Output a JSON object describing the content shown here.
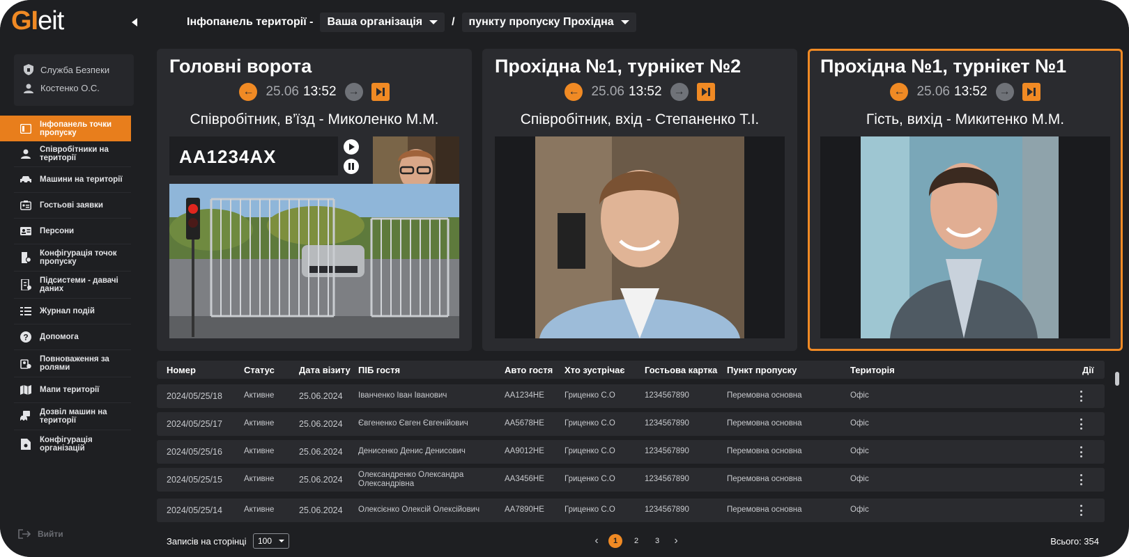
{
  "app": {
    "logo_prefix": "GI",
    "logo_suffix": "eit"
  },
  "header": {
    "title": "Інфопанель території -",
    "org_select": "Ваша організація",
    "separator": "/",
    "checkpoint_select": "пункту пропуску Прохідна"
  },
  "user": {
    "service": "Служба Безпеки",
    "name": "Костенко О.С."
  },
  "sidebar": {
    "items": [
      {
        "label": "Інфопанель точки пропуску",
        "icon": "dashboard-icon",
        "active": true
      },
      {
        "label": "Співробітники на території",
        "icon": "person-icon"
      },
      {
        "label": "Машини на території",
        "icon": "car-icon"
      },
      {
        "label": "Гостьові заявки",
        "icon": "guest-card-icon"
      },
      {
        "label": "Персони",
        "icon": "id-card-icon"
      },
      {
        "label": "Конфігурація точок пропуску",
        "icon": "door-config-icon"
      },
      {
        "label": "Підсистеми - давачі даних",
        "icon": "subsystems-icon"
      },
      {
        "label": "Журнал подій",
        "icon": "event-log-icon"
      },
      {
        "label": "Допомога",
        "icon": "help-icon"
      },
      {
        "label": "Повноваження за ролями",
        "icon": "roles-icon"
      },
      {
        "label": "Мапи території",
        "icon": "map-icon"
      },
      {
        "label": "Дозвіл машин на території",
        "icon": "vehicle-permit-icon"
      },
      {
        "label": "Конфігурація організацій",
        "icon": "org-config-icon"
      }
    ],
    "logout": "Вийти"
  },
  "cards": [
    {
      "title": "Головні ворота",
      "date": "25.06",
      "time": "13:52",
      "subtitle": "Співробітник, в’їзд - Миколенко М.М.",
      "plate": "AA1234AX"
    },
    {
      "title": "Прохідна №1, турнікет №2",
      "date": "25.06",
      "time": "13:52",
      "subtitle": "Співробітник, вхід - Степаненко Т.І."
    },
    {
      "title": "Прохідна №1, турнікет №1",
      "date": "25.06",
      "time": "13:52",
      "subtitle": "Гість, вихід - Микитенко М.М."
    }
  ],
  "table": {
    "columns": [
      "Номер",
      "Статус",
      "Дата візиту",
      "ПІБ гостя",
      "Авто гостя",
      "Хто зустрічає",
      "Гостьова картка",
      "Пункт пропуску",
      "Територія",
      "Дії"
    ],
    "rows": [
      [
        "2024/05/25/18",
        "Активне",
        "25.06.2024",
        "Іванченко Іван Іванович",
        "AA1234HE",
        "Гриценко С.О",
        "1234567890",
        "Перемовна основна",
        "Офіс"
      ],
      [
        "2024/05/25/17",
        "Активне",
        "25.06.2024",
        "Євгененко Євген Євгенійович",
        "AA5678HE",
        "Гриценко С.О",
        "1234567890",
        "Перемовна основна",
        "Офіс"
      ],
      [
        "2024/05/25/16",
        "Активне",
        "25.06.2024",
        "Денисенко Денис Денисович",
        "AA9012HE",
        "Гриценко С.О",
        "1234567890",
        "Перемовна основна",
        "Офіс"
      ],
      [
        "2024/05/25/15",
        "Активне",
        "25.06.2024",
        "Олександренко Олександра Олександрівна",
        "AA3456HE",
        "Гриценко С.О",
        "1234567890",
        "Перемовна основна",
        "Офіс"
      ],
      [
        "2024/05/25/14",
        "Активне",
        "25.06.2024",
        "Олексієнко Олексій Олексійович",
        "AA7890HE",
        "Гриценко С.О",
        "1234567890",
        "Перемовна основна",
        "Офіс"
      ]
    ],
    "footer": {
      "rows_per_page_label": "Записів на сторінці",
      "rows_per_page": "100",
      "pages": [
        "1",
        "2",
        "3"
      ],
      "current_page": "1",
      "total": "Всього: 354"
    }
  },
  "colors": {
    "accent": "#f08a24",
    "background": "#1e1f22",
    "panel": "#2a2b2f"
  }
}
